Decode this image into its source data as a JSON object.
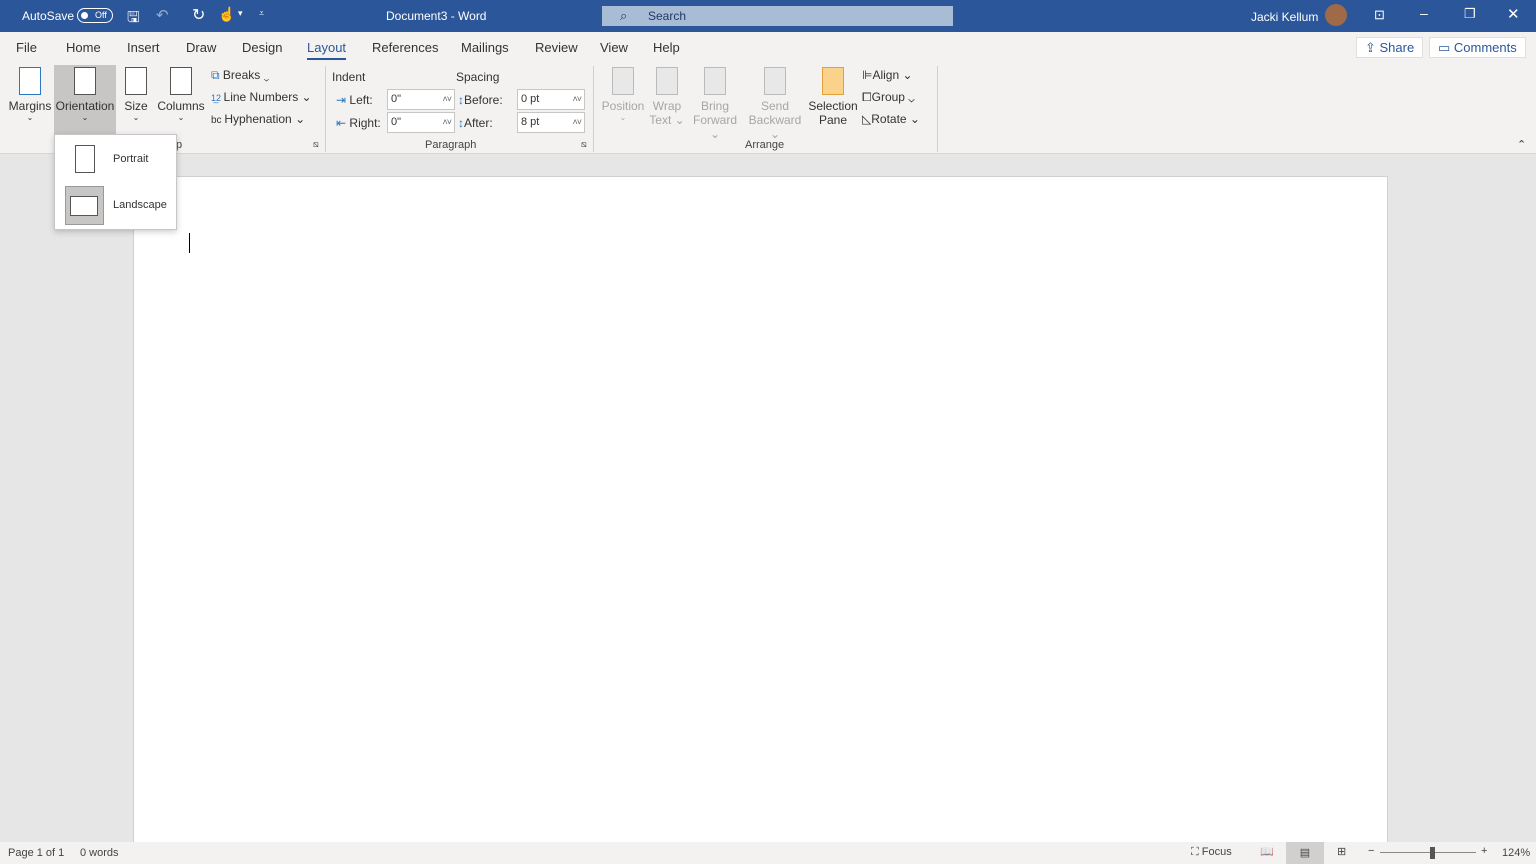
{
  "titlebar": {
    "autosave_label": "AutoSave",
    "autosave_state": "Off",
    "document_title": "Document3  -  Word",
    "search_placeholder": "Search",
    "user_name": "Jacki Kellum"
  },
  "menu": {
    "tabs": [
      "File",
      "Home",
      "Insert",
      "Draw",
      "Design",
      "Layout",
      "References",
      "Mailings",
      "Review",
      "View",
      "Help"
    ],
    "active": "Layout",
    "share": "Share",
    "comments": "Comments"
  },
  "ribbon": {
    "page_setup": {
      "margins": "Margins",
      "orientation": "Orientation",
      "size": "Size",
      "columns": "Columns",
      "breaks": "Breaks",
      "line_numbers": "Line Numbers",
      "hyphenation": "Hyphenation",
      "group_label": "p"
    },
    "paragraph": {
      "indent": "Indent",
      "spacing": "Spacing",
      "left": "Left:",
      "right": "Right:",
      "before": "Before:",
      "after": "After:",
      "left_value": "0\"",
      "right_value": "0\"",
      "before_value": "0 pt",
      "after_value": "8 pt",
      "group_label": "Paragraph"
    },
    "arrange": {
      "position": "Position",
      "wrap_text_1": "Wrap",
      "wrap_text_2": "Text",
      "bring_forward_1": "Bring",
      "bring_forward_2": "Forward",
      "send_backward_1": "Send",
      "send_backward_2": "Backward",
      "selection_pane_1": "Selection",
      "selection_pane_2": "Pane",
      "align": "Align",
      "group": "Group",
      "rotate": "Rotate",
      "group_label": "Arrange"
    }
  },
  "orientation_menu": {
    "items": [
      "Portrait",
      "Landscape"
    ],
    "selected": "Landscape"
  },
  "status": {
    "page": "Page 1 of 1",
    "words": "0 words",
    "focus": "Focus",
    "zoom": "124%"
  },
  "colors": {
    "brand": "#2b579a",
    "ribbon": "#f3f2f1"
  }
}
